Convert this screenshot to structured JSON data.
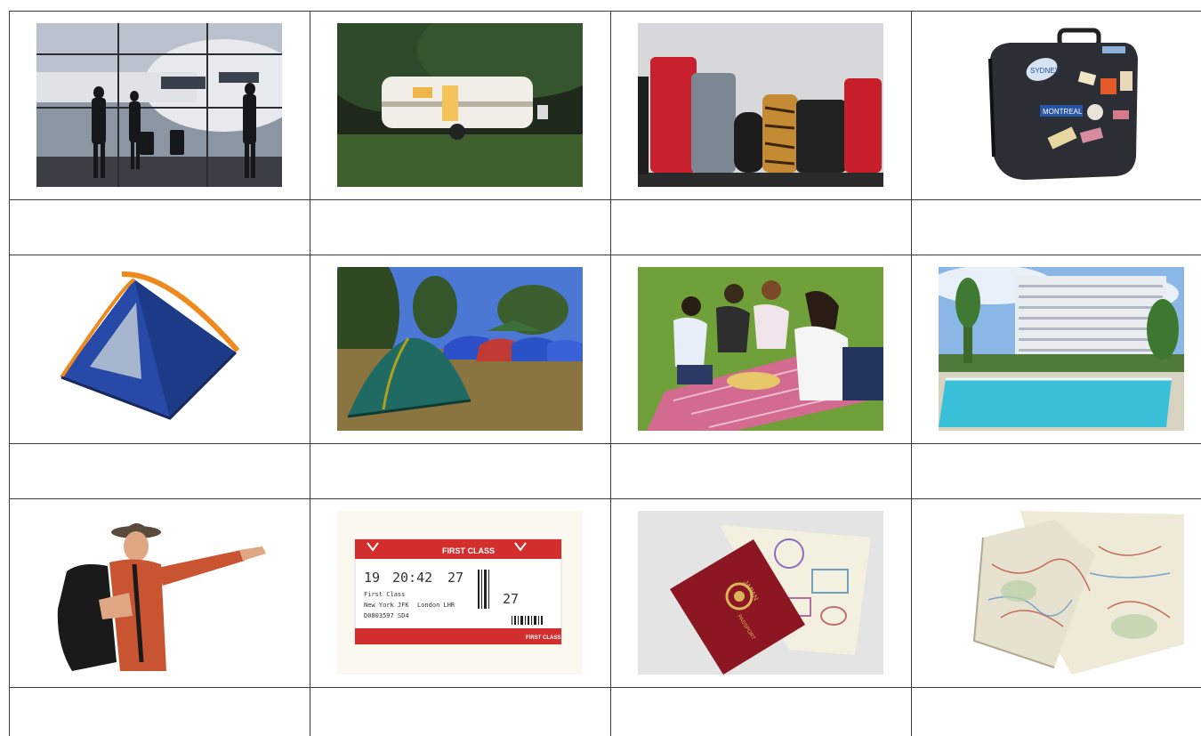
{
  "grid": {
    "rows": [
      {
        "images": [
          {
            "name": "airport-photo"
          },
          {
            "name": "caravan-photo"
          },
          {
            "name": "luggage-photo"
          },
          {
            "name": "suitcase-with-stickers-photo",
            "stickers": [
              "SYDNEY",
              "MONTREAL"
            ]
          }
        ],
        "captions": [
          "",
          "",
          "",
          ""
        ]
      },
      {
        "images": [
          {
            "name": "tent-photo"
          },
          {
            "name": "campsite-photo"
          },
          {
            "name": "picnic-photo"
          },
          {
            "name": "hotel-pool-photo"
          }
        ],
        "captions": [
          "",
          "",
          "",
          ""
        ]
      },
      {
        "images": [
          {
            "name": "backpacker-photo"
          },
          {
            "name": "boarding-pass-photo",
            "ticket": {
              "class_label": "FIRST CLASS",
              "date": "19",
              "time": "20:42",
              "gate": "27",
              "seat": "27",
              "class_line": "First Class",
              "from": "New York JFK",
              "to": "London LHR",
              "number": "D0803597 SD4"
            }
          },
          {
            "name": "passport-photo",
            "cover": [
              "JAPAN",
              "PASSPORT"
            ]
          },
          {
            "name": "map-photo"
          }
        ],
        "captions": [
          "",
          "",
          "",
          ""
        ]
      }
    ]
  }
}
